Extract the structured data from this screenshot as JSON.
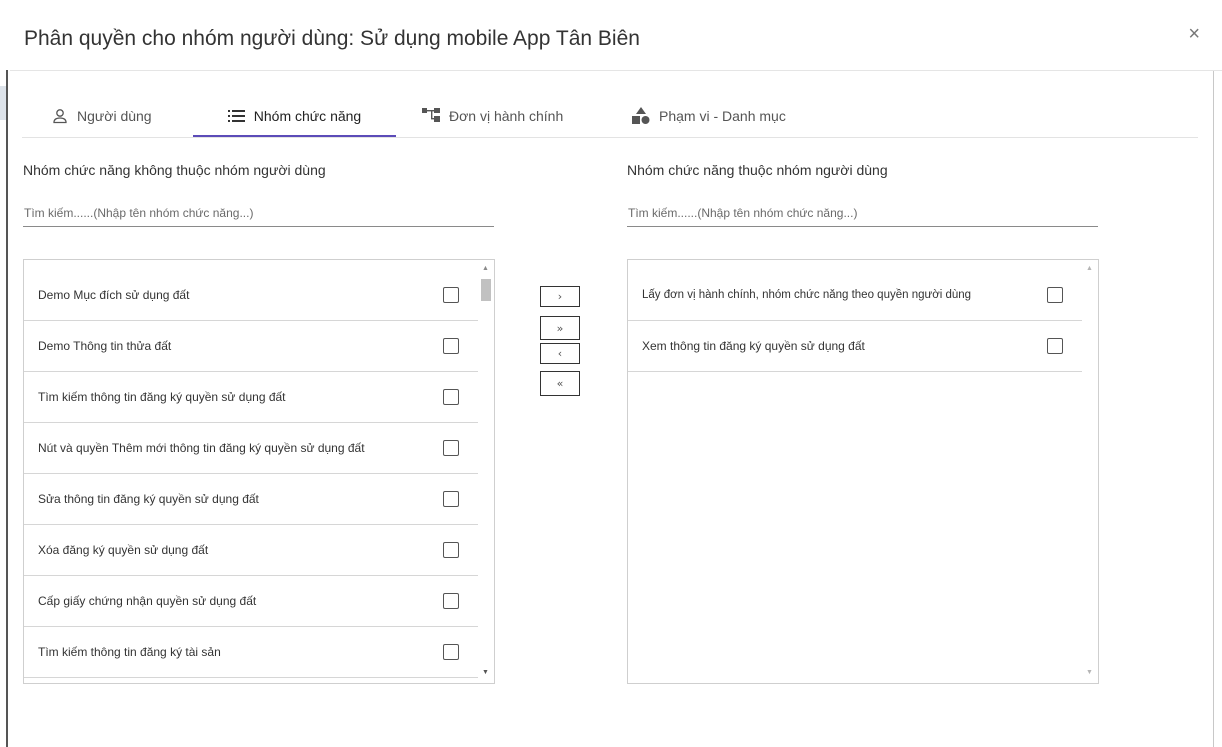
{
  "header": {
    "title": "Phân quyền cho nhóm người dùng: Sử dụng mobile App Tân Biên",
    "close_label": "×"
  },
  "tabs": [
    {
      "label": "Người dùng",
      "icon": "user-icon"
    },
    {
      "label": "Nhóm chức năng",
      "icon": "list-icon"
    },
    {
      "label": "Đơn vị hành chính",
      "icon": "hierarchy-icon"
    },
    {
      "label": "Phạm vi - Danh mục",
      "icon": "shapes-icon"
    }
  ],
  "left": {
    "title": "Nhóm chức năng không thuộc nhóm người dùng",
    "search_placeholder": "Tìm kiếm......(Nhập tên nhóm chức năng...)",
    "items": [
      "Demo Mục đích sử dụng đất",
      "Demo Thông tin thửa đất",
      "Tìm kiếm thông tin đăng ký quyền sử dụng đất",
      "Nút và quyền Thêm mới thông tin đăng ký quyền sử dụng đất",
      "Sửa thông tin đăng ký quyền sử dụng đất",
      "Xóa đăng ký quyền sử dụng đất",
      "Cấp giấy chứng nhận quyền sử dụng đất",
      "Tìm kiếm thông tin đăng ký tài sản"
    ]
  },
  "right": {
    "title": "Nhóm chức năng thuộc nhóm người dùng",
    "search_placeholder": "Tìm kiếm......(Nhập tên nhóm chức năng...)",
    "items": [
      "Lấy đơn vị hành chính, nhóm chức năng theo quyền người dùng",
      "Xem thông tin đăng ký quyền sử dụng đất"
    ]
  },
  "move_buttons": {
    "move_right": "›",
    "move_all_right": "»",
    "move_left": "‹",
    "move_all_left": "«"
  },
  "colors": {
    "active_tab_underline": "#5c4bb8"
  }
}
